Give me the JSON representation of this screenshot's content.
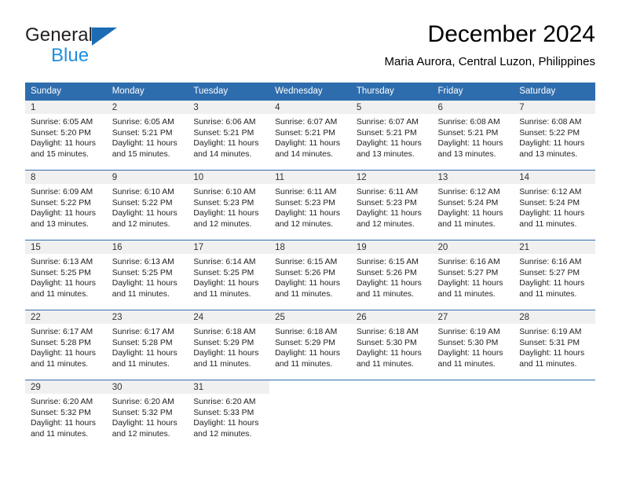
{
  "logo": {
    "word1": "General",
    "word2": "Blue",
    "mark": "triangle-icon"
  },
  "header": {
    "title": "December 2024",
    "subtitle": "Maria Aurora, Central Luzon, Philippines"
  },
  "colors": {
    "header_blue": "#2e6dad",
    "logo_blue": "#1f8fe0",
    "daynum_band": "#f0f0f0"
  },
  "weekdays": [
    "Sunday",
    "Monday",
    "Tuesday",
    "Wednesday",
    "Thursday",
    "Friday",
    "Saturday"
  ],
  "weeks": [
    [
      {
        "day": "1",
        "sunrise": "Sunrise: 6:05 AM",
        "sunset": "Sunset: 5:20 PM",
        "daylight1": "Daylight: 11 hours",
        "daylight2": "and 15 minutes."
      },
      {
        "day": "2",
        "sunrise": "Sunrise: 6:05 AM",
        "sunset": "Sunset: 5:21 PM",
        "daylight1": "Daylight: 11 hours",
        "daylight2": "and 15 minutes."
      },
      {
        "day": "3",
        "sunrise": "Sunrise: 6:06 AM",
        "sunset": "Sunset: 5:21 PM",
        "daylight1": "Daylight: 11 hours",
        "daylight2": "and 14 minutes."
      },
      {
        "day": "4",
        "sunrise": "Sunrise: 6:07 AM",
        "sunset": "Sunset: 5:21 PM",
        "daylight1": "Daylight: 11 hours",
        "daylight2": "and 14 minutes."
      },
      {
        "day": "5",
        "sunrise": "Sunrise: 6:07 AM",
        "sunset": "Sunset: 5:21 PM",
        "daylight1": "Daylight: 11 hours",
        "daylight2": "and 13 minutes."
      },
      {
        "day": "6",
        "sunrise": "Sunrise: 6:08 AM",
        "sunset": "Sunset: 5:21 PM",
        "daylight1": "Daylight: 11 hours",
        "daylight2": "and 13 minutes."
      },
      {
        "day": "7",
        "sunrise": "Sunrise: 6:08 AM",
        "sunset": "Sunset: 5:22 PM",
        "daylight1": "Daylight: 11 hours",
        "daylight2": "and 13 minutes."
      }
    ],
    [
      {
        "day": "8",
        "sunrise": "Sunrise: 6:09 AM",
        "sunset": "Sunset: 5:22 PM",
        "daylight1": "Daylight: 11 hours",
        "daylight2": "and 13 minutes."
      },
      {
        "day": "9",
        "sunrise": "Sunrise: 6:10 AM",
        "sunset": "Sunset: 5:22 PM",
        "daylight1": "Daylight: 11 hours",
        "daylight2": "and 12 minutes."
      },
      {
        "day": "10",
        "sunrise": "Sunrise: 6:10 AM",
        "sunset": "Sunset: 5:23 PM",
        "daylight1": "Daylight: 11 hours",
        "daylight2": "and 12 minutes."
      },
      {
        "day": "11",
        "sunrise": "Sunrise: 6:11 AM",
        "sunset": "Sunset: 5:23 PM",
        "daylight1": "Daylight: 11 hours",
        "daylight2": "and 12 minutes."
      },
      {
        "day": "12",
        "sunrise": "Sunrise: 6:11 AM",
        "sunset": "Sunset: 5:23 PM",
        "daylight1": "Daylight: 11 hours",
        "daylight2": "and 12 minutes."
      },
      {
        "day": "13",
        "sunrise": "Sunrise: 6:12 AM",
        "sunset": "Sunset: 5:24 PM",
        "daylight1": "Daylight: 11 hours",
        "daylight2": "and 11 minutes."
      },
      {
        "day": "14",
        "sunrise": "Sunrise: 6:12 AM",
        "sunset": "Sunset: 5:24 PM",
        "daylight1": "Daylight: 11 hours",
        "daylight2": "and 11 minutes."
      }
    ],
    [
      {
        "day": "15",
        "sunrise": "Sunrise: 6:13 AM",
        "sunset": "Sunset: 5:25 PM",
        "daylight1": "Daylight: 11 hours",
        "daylight2": "and 11 minutes."
      },
      {
        "day": "16",
        "sunrise": "Sunrise: 6:13 AM",
        "sunset": "Sunset: 5:25 PM",
        "daylight1": "Daylight: 11 hours",
        "daylight2": "and 11 minutes."
      },
      {
        "day": "17",
        "sunrise": "Sunrise: 6:14 AM",
        "sunset": "Sunset: 5:25 PM",
        "daylight1": "Daylight: 11 hours",
        "daylight2": "and 11 minutes."
      },
      {
        "day": "18",
        "sunrise": "Sunrise: 6:15 AM",
        "sunset": "Sunset: 5:26 PM",
        "daylight1": "Daylight: 11 hours",
        "daylight2": "and 11 minutes."
      },
      {
        "day": "19",
        "sunrise": "Sunrise: 6:15 AM",
        "sunset": "Sunset: 5:26 PM",
        "daylight1": "Daylight: 11 hours",
        "daylight2": "and 11 minutes."
      },
      {
        "day": "20",
        "sunrise": "Sunrise: 6:16 AM",
        "sunset": "Sunset: 5:27 PM",
        "daylight1": "Daylight: 11 hours",
        "daylight2": "and 11 minutes."
      },
      {
        "day": "21",
        "sunrise": "Sunrise: 6:16 AM",
        "sunset": "Sunset: 5:27 PM",
        "daylight1": "Daylight: 11 hours",
        "daylight2": "and 11 minutes."
      }
    ],
    [
      {
        "day": "22",
        "sunrise": "Sunrise: 6:17 AM",
        "sunset": "Sunset: 5:28 PM",
        "daylight1": "Daylight: 11 hours",
        "daylight2": "and 11 minutes."
      },
      {
        "day": "23",
        "sunrise": "Sunrise: 6:17 AM",
        "sunset": "Sunset: 5:28 PM",
        "daylight1": "Daylight: 11 hours",
        "daylight2": "and 11 minutes."
      },
      {
        "day": "24",
        "sunrise": "Sunrise: 6:18 AM",
        "sunset": "Sunset: 5:29 PM",
        "daylight1": "Daylight: 11 hours",
        "daylight2": "and 11 minutes."
      },
      {
        "day": "25",
        "sunrise": "Sunrise: 6:18 AM",
        "sunset": "Sunset: 5:29 PM",
        "daylight1": "Daylight: 11 hours",
        "daylight2": "and 11 minutes."
      },
      {
        "day": "26",
        "sunrise": "Sunrise: 6:18 AM",
        "sunset": "Sunset: 5:30 PM",
        "daylight1": "Daylight: 11 hours",
        "daylight2": "and 11 minutes."
      },
      {
        "day": "27",
        "sunrise": "Sunrise: 6:19 AM",
        "sunset": "Sunset: 5:30 PM",
        "daylight1": "Daylight: 11 hours",
        "daylight2": "and 11 minutes."
      },
      {
        "day": "28",
        "sunrise": "Sunrise: 6:19 AM",
        "sunset": "Sunset: 5:31 PM",
        "daylight1": "Daylight: 11 hours",
        "daylight2": "and 11 minutes."
      }
    ],
    [
      {
        "day": "29",
        "sunrise": "Sunrise: 6:20 AM",
        "sunset": "Sunset: 5:32 PM",
        "daylight1": "Daylight: 11 hours",
        "daylight2": "and 11 minutes."
      },
      {
        "day": "30",
        "sunrise": "Sunrise: 6:20 AM",
        "sunset": "Sunset: 5:32 PM",
        "daylight1": "Daylight: 11 hours",
        "daylight2": "and 12 minutes."
      },
      {
        "day": "31",
        "sunrise": "Sunrise: 6:20 AM",
        "sunset": "Sunset: 5:33 PM",
        "daylight1": "Daylight: 11 hours",
        "daylight2": "and 12 minutes."
      },
      {
        "day": "",
        "sunrise": "",
        "sunset": "",
        "daylight1": "",
        "daylight2": ""
      },
      {
        "day": "",
        "sunrise": "",
        "sunset": "",
        "daylight1": "",
        "daylight2": ""
      },
      {
        "day": "",
        "sunrise": "",
        "sunset": "",
        "daylight1": "",
        "daylight2": ""
      },
      {
        "day": "",
        "sunrise": "",
        "sunset": "",
        "daylight1": "",
        "daylight2": ""
      }
    ]
  ]
}
